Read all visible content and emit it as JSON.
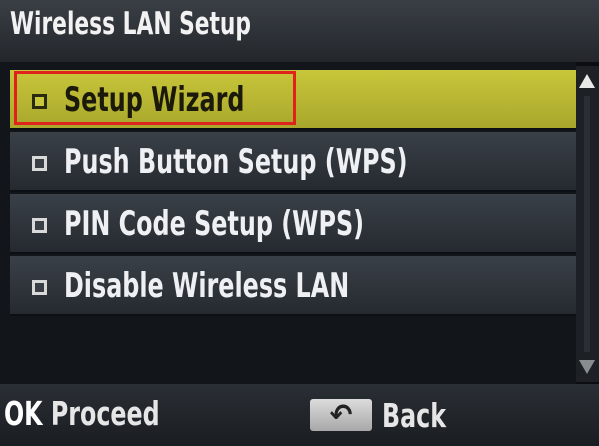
{
  "title": "Wireless LAN Setup",
  "menu": {
    "items": [
      {
        "label": "Setup Wizard",
        "selected": true
      },
      {
        "label": "Push Button Setup (WPS)",
        "selected": false
      },
      {
        "label": "PIN Code Setup (WPS)",
        "selected": false
      },
      {
        "label": "Disable Wireless LAN",
        "selected": false
      }
    ]
  },
  "softkeys": {
    "ok_tag": "OK",
    "ok_label": "Proceed",
    "back_icon_glyph": "↶",
    "back_label": "Back"
  },
  "colors": {
    "selected_bg": "#c8c63a",
    "highlight_border": "#e0221c"
  },
  "icons": {
    "bullet": "square-bullet-icon",
    "scroll_up": "scroll-up-arrow-icon",
    "scroll_down": "scroll-down-arrow-icon",
    "back": "back-arrow-icon"
  }
}
